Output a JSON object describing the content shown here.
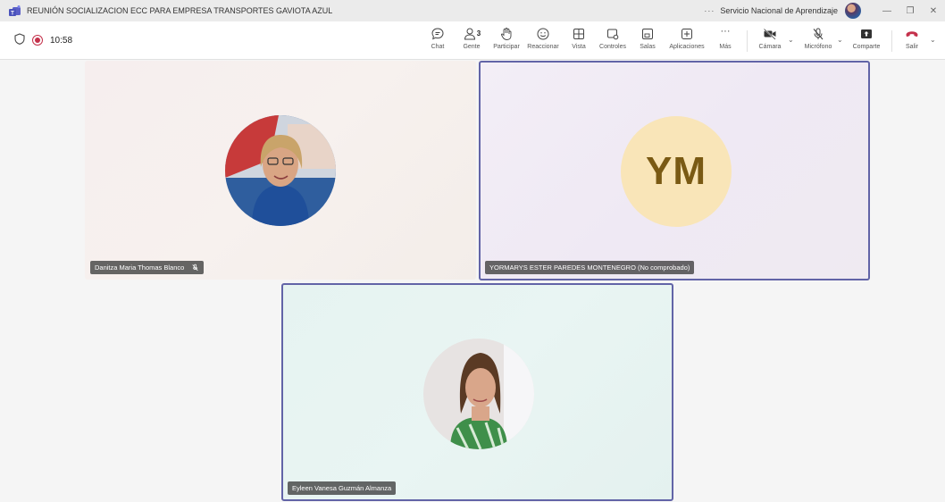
{
  "window": {
    "title": "REUNIÓN SOCIALIZACION ECC PARA EMPRESA TRANSPORTES GAVIOTA AZUL",
    "more": "···",
    "organization": "Servicio Nacional de Aprendizaje",
    "minimize": "—",
    "restore": "❐",
    "close": "✕"
  },
  "meeting": {
    "elapsed": "10:58"
  },
  "toolbar": {
    "chat": "Chat",
    "people": "Gente",
    "people_count": "3",
    "raise": "Participar",
    "react": "Reaccionar",
    "view": "Vista",
    "controls": "Controles",
    "rooms": "Salas",
    "apps": "Aplicaciones",
    "more": "Más",
    "more_glyph": "···",
    "camera": "Cámara",
    "mic": "Micrófono",
    "share": "Comparte",
    "leave": "Salir"
  },
  "participants": [
    {
      "name": "Danitza Maria Thomas Blanco",
      "muted": true
    },
    {
      "name": "YORMARYS ESTER PAREDES MONTENEGRO (No comprobado)",
      "initials": "YM"
    },
    {
      "name": "Eyleen Vanesa Guzmán Almanza"
    }
  ],
  "colors": {
    "accent": "#6264a7",
    "record": "#c4314b",
    "leave": "#c4314b",
    "initials_bg": "#f9e5b8",
    "initials_text": "#7a5a14"
  }
}
